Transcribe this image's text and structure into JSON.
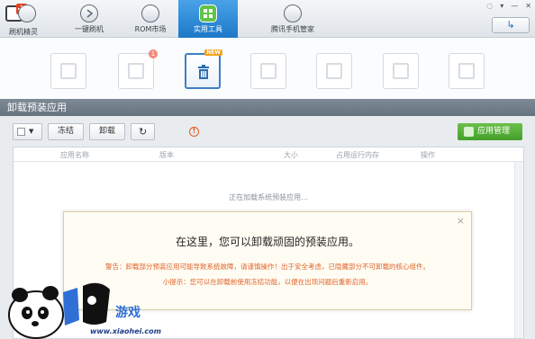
{
  "nav": {
    "items": [
      {
        "label": "刷机精灵",
        "icon": "gear-icon"
      },
      {
        "label": "一键刷机",
        "icon": "play-icon"
      },
      {
        "label": "ROM市场",
        "icon": "robot-icon"
      },
      {
        "label": "实用工具",
        "icon": "grid-icon",
        "active": true
      },
      {
        "label": "腾讯手机管家",
        "icon": "shield-icon"
      }
    ]
  },
  "tools": [
    {
      "icon": "bag-icon"
    },
    {
      "icon": "puzzle-icon",
      "badge": "1"
    },
    {
      "icon": "trash-icon",
      "badge": "NEW",
      "active": true
    },
    {
      "icon": "document-icon"
    },
    {
      "icon": "export-icon"
    },
    {
      "icon": "settings-doc-icon"
    },
    {
      "icon": "tools-icon"
    }
  ],
  "section_title": "卸载预装应用",
  "toolbar": {
    "freeze_label": "冻结",
    "uninstall_label": "卸载",
    "refresh_icon": "refresh-icon",
    "manager_label": "应用管理"
  },
  "table": {
    "headers": [
      "应用名称",
      "版本",
      "大小",
      "占用运行内存",
      "操作"
    ],
    "loading_text": "正在加载系统预装应用..."
  },
  "dialog": {
    "close_symbol": "×",
    "main_text": "在这里，您可以卸载顽固的预装应用。",
    "warning_text": "警告：卸载部分预装应用可能导致系统故障，请谨慎操作！出于安全考虑，已隐藏部分不可卸载的核心组件。",
    "tip_text": "小提示：您可以在卸载前使用冻结功能，以便在出现问题后重新启用。"
  },
  "watermark": {
    "text": "www.xiaohei.com",
    "accent": "#2f6fd6"
  },
  "colors": {
    "nav_active": "#2a8ad8",
    "section_bar": "#717d89",
    "manager_button": "#55b037",
    "warning_text": "#e0622a"
  }
}
